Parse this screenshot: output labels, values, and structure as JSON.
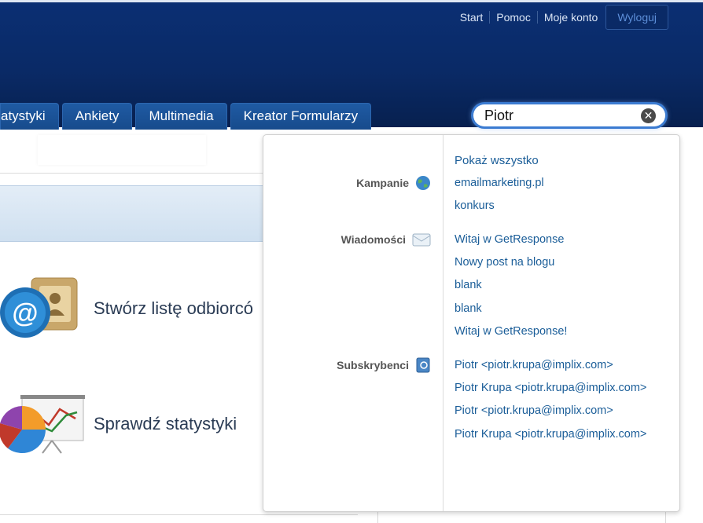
{
  "header": {
    "links": [
      "Start",
      "Pomoc",
      "Moje konto"
    ],
    "logout": "Wyloguj",
    "tabs": [
      "atystyki",
      "Ankiety",
      "Multimedia",
      "Kreator Formularzy"
    ],
    "search": {
      "value": "Piotr",
      "clear_icon": "clear-icon"
    }
  },
  "main": {
    "feature1": "Stwórz listę odbiorcó",
    "feature2": "Sprawdź statystyki"
  },
  "dropdown": {
    "categories": {
      "kampanie": "Kampanie",
      "wiadomosci": "Wiadomości",
      "subskrybenci": "Subskrybenci"
    },
    "show_all": "Pokaż wszystko",
    "kampanie": [
      "emailmarketing.pl",
      "konkurs"
    ],
    "wiadomosci": [
      "Witaj w GetResponse",
      "Nowy post na blogu",
      "blank",
      "blank",
      "Witaj w GetResponse!"
    ],
    "subskrybenci": [
      "Piotr <piotr.krupa@implix.com>",
      "Piotr Krupa <piotr.krupa@implix.com>",
      "Piotr <piotr.krupa@implix.com>",
      "Piotr Krupa <piotr.krupa@implix.com>"
    ]
  },
  "colors": {
    "header": "#0a2a66",
    "link": "#1a5d98",
    "tab": "#1f5aa3"
  }
}
